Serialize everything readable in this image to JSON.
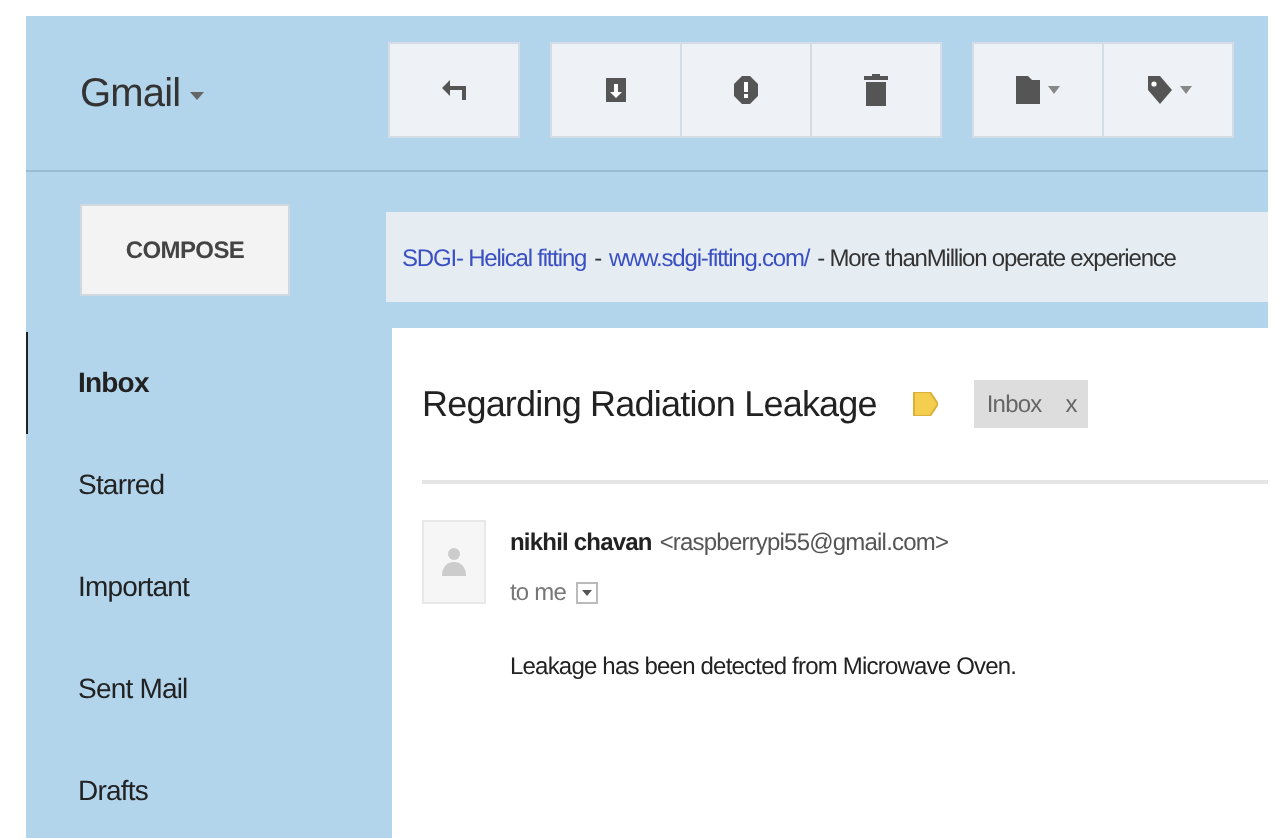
{
  "header": {
    "logo": "Gmail"
  },
  "toolbar": {
    "groups": [
      [
        {
          "kind": "reply"
        }
      ],
      [
        {
          "kind": "archive"
        },
        {
          "kind": "spam"
        },
        {
          "kind": "delete"
        }
      ],
      [
        {
          "kind": "move"
        },
        {
          "kind": "label"
        }
      ]
    ]
  },
  "compose": "COMPOSE",
  "folders": [
    {
      "label": "Inbox",
      "selected": true
    },
    {
      "label": "Starred",
      "selected": false
    },
    {
      "label": "Important",
      "selected": false
    },
    {
      "label": "Sent Mail",
      "selected": false
    },
    {
      "label": "Drafts",
      "selected": false
    }
  ],
  "ad": {
    "title": "SDGI- Helical fitting",
    "separator": "-",
    "url": "www.sdgi-fitting.com/",
    "text": "- More thanMillion operate experience"
  },
  "message": {
    "subject": "Regarding Radiation Leakage",
    "important": true,
    "tag": {
      "label": "Inbox",
      "remove": "x"
    },
    "sender": "nikhil chavan",
    "email": "<raspberrypi55@gmail.com>",
    "to": "to me",
    "body": "Leakage has been detected from Microwave Oven."
  }
}
